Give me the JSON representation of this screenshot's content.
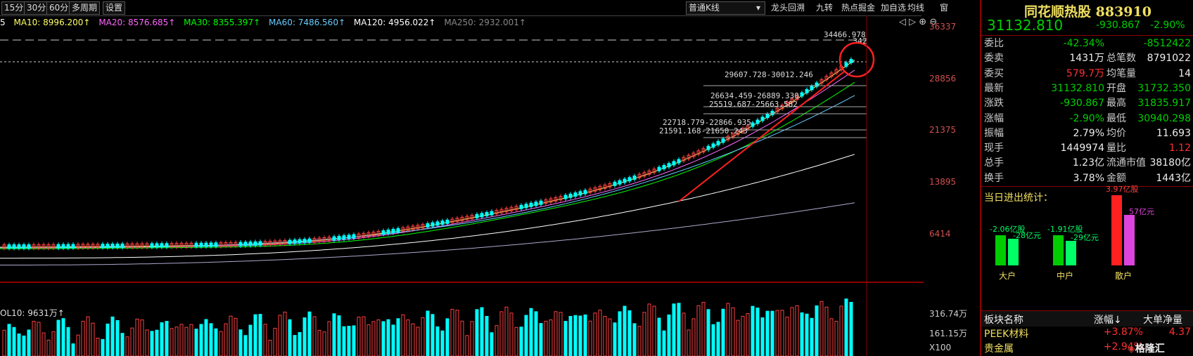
{
  "toolbar": {
    "periods": [
      "15分",
      "30分",
      "60分",
      "多周期",
      "设置"
    ],
    "kline_type": "普通K线",
    "tools": [
      "龙头回溯",
      "九转",
      "热点掘金",
      "加自选",
      "均线",
      "窗"
    ]
  },
  "ma_legend": {
    "ma5_suffix": "5",
    "ma10": "MA10: 8996.200↑",
    "ma20": "MA20: 8576.685↑",
    "ma30": "MA30: 8355.397↑",
    "ma60": "MA60: 7486.560↑",
    "ma120": "MA120: 4956.022↑",
    "ma250": "MA250: 2932.001↑",
    "colors": {
      "ma10": "#ffff66",
      "ma20": "#ff66ff",
      "ma30": "#00ff00",
      "ma60": "#66ccff",
      "ma120": "#ffffff",
      "ma250": "#888888"
    }
  },
  "price_axis": [
    "36337",
    "28856",
    "21375",
    "13895",
    "6414"
  ],
  "volume_axis": [
    "316.74万",
    "161.15万",
    "X100"
  ],
  "volume_title": "OL10: 9631万↑",
  "chart_annotations": [
    "34466.978",
    "29607.728-30012.246",
    "26634.459-26889.330",
    "25519.687-25663.582",
    "22718.779-22866.935",
    "21591.168-21650.243"
  ],
  "chart_extra_label": "342",
  "stock": {
    "title": "同花顺热股 883910",
    "price": "31132.810",
    "change": "-930.867",
    "change_pct": "-2.90%"
  },
  "quote_rows": [
    {
      "l1": "委比",
      "v1": "-42.34%",
      "l2": "",
      "v2": "-8512422",
      "c1": "grn",
      "c2": "grn"
    },
    {
      "l1": "委卖",
      "v1": "1431万",
      "l2": "总笔数",
      "v2": "8791022",
      "c1": "wht",
      "c2": "wht"
    },
    {
      "l1": "委买",
      "v1": "579.7万",
      "l2": "均笔量",
      "v2": "14",
      "c1": "red",
      "c2": "wht"
    },
    {
      "l1": "最新",
      "v1": "31132.810",
      "l2": "开盘",
      "v2": "31732.350",
      "c1": "grn",
      "c2": "grn"
    },
    {
      "l1": "涨跌",
      "v1": "-930.867",
      "l2": "最高",
      "v2": "31835.917",
      "c1": "grn",
      "c2": "grn"
    },
    {
      "l1": "涨幅",
      "v1": "-2.90%",
      "l2": "最低",
      "v2": "30940.298",
      "c1": "grn",
      "c2": "grn"
    },
    {
      "l1": "振幅",
      "v1": "2.79%",
      "l2": "均价",
      "v2": "11.693",
      "c1": "wht",
      "c2": "wht"
    },
    {
      "l1": "现手",
      "v1": "1449974",
      "l2": "量比",
      "v2": "1.12",
      "c1": "wht",
      "c2": "red"
    },
    {
      "l1": "总手",
      "v1": "1.23亿",
      "l2": "流通市值",
      "v2": "38180亿",
      "c1": "wht",
      "c2": "wht"
    },
    {
      "l1": "换手",
      "v1": "3.78%",
      "l2": "金额",
      "v2": "1443亿",
      "c1": "wht",
      "c2": "wht"
    }
  ],
  "inout": {
    "title": "当日进出统计：",
    "groups": [
      {
        "name": "大户",
        "top": "-2.06亿股",
        "sub": "-28亿元",
        "tall": 0.43,
        "short": 0.38,
        "c1": "#00cc00",
        "c2": "#00ff66"
      },
      {
        "name": "中户",
        "top": "-1.91亿股",
        "sub": "-29亿元",
        "tall": 0.43,
        "short": 0.35,
        "c1": "#00cc00",
        "c2": "#00ff66"
      },
      {
        "name": "散户",
        "top": "3.97亿股",
        "sub": "57亿元",
        "tall": 1.0,
        "short": 0.72,
        "c1": "#ff2020",
        "c2": "#dd44dd"
      }
    ]
  },
  "sector_table": {
    "headers": [
      "板块名称",
      "涨幅↓",
      "大单净量"
    ],
    "rows": [
      {
        "name": "PEEK材料",
        "pct": "+3.87%",
        "net": "4.37"
      },
      {
        "name": "贵金属",
        "pct": "+2.94%",
        "net": ""
      }
    ]
  },
  "watermark": "格隆汇"
}
